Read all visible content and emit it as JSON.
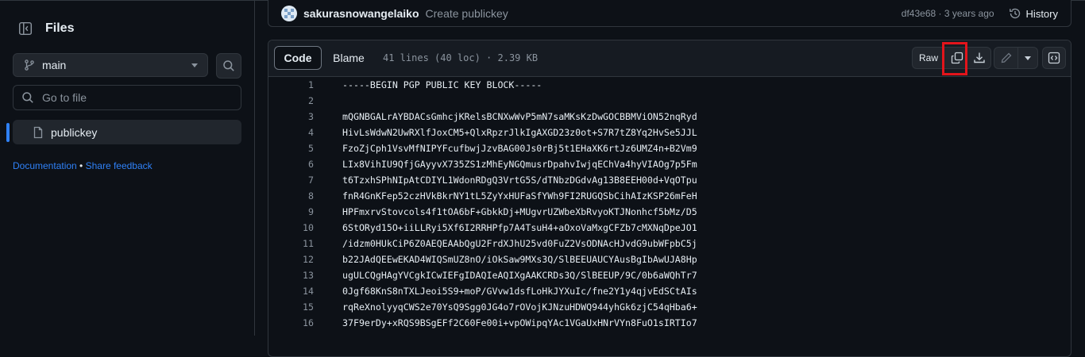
{
  "sidebar": {
    "title": "Files",
    "branch": "main",
    "search_placeholder": "Go to file",
    "tree": [
      {
        "label": "publickey"
      }
    ],
    "links": {
      "documentation": "Documentation",
      "separator": " • ",
      "feedback": "Share feedback"
    }
  },
  "commit": {
    "author": "sakurasnowangelaiko",
    "message": "Create publickey",
    "sha_age": "df43e68 · 3 years ago",
    "history_label": "History"
  },
  "file": {
    "tabs": {
      "code": "Code",
      "blame": "Blame"
    },
    "info": "41 lines (40 loc) · 2.39 KB",
    "raw_label": "Raw",
    "lines": [
      {
        "n": "1",
        "text": "-----BEGIN PGP PUBLIC KEY BLOCK-----"
      },
      {
        "n": "2",
        "text": ""
      },
      {
        "n": "3",
        "text": "mQGNBGALrAYBDACsGmhcjKRelsBCNXwWvP5mN7saMKsKzDwGOCBBMViON52nqRyd"
      },
      {
        "n": "4",
        "text": "HivLsWdwN2UwRXlfJoxCM5+QlxRpzrJlkIgAXGD23z0ot+S7R7tZ8Yq2HvSe5JJL"
      },
      {
        "n": "5",
        "text": "FzoZjCph1VsvMfNIPYFcufbwjJzvBAG00Js0rBj5t1EHaXK6rtJz6UMZ4n+B2Vm9"
      },
      {
        "n": "6",
        "text": "LIx8VihIU9QfjGAyyvX735ZS1zMhEyNGQmusrDpahvIwjqEChVa4hyVIAOg7p5Fm"
      },
      {
        "n": "7",
        "text": "t6TzxhSPhNIpAtCDIYL1WdonRDgQ3VrtG5S/dTNbzDGdvAg13B8EEH00d+VqOTpu"
      },
      {
        "n": "8",
        "text": "fnR4GnKFep52czHVkBkrNY1tL5ZyYxHUFaSfYWh9FI2RUGQSbCihAIzKSP26mFeH"
      },
      {
        "n": "9",
        "text": "HPFmxrvStovcols4f1tOA6bF+GbkkDj+MUgvrUZWbeXbRvyoKTJNonhcf5bMz/D5"
      },
      {
        "n": "10",
        "text": "6StORyd15O+iiLLRyi5Xf6I2RRHPfp7A4TsuH4+aOxoVaMxgCFZb7cMXNqDpeJO1"
      },
      {
        "n": "11",
        "text": "/idzm0HUkCiP6Z0AEQEAAbQgU2FrdXJhU25vd0FuZ2VsODNAcHJvdG9ubWFpbC5j"
      },
      {
        "n": "12",
        "text": "b22JAdQEEwEKAD4WIQSmUZ8nO/iOkSaw9MXs3Q/SlBEEUAUCYAusBgIbAwUJA8Hp"
      },
      {
        "n": "13",
        "text": "ugULCQgHAgYVCgkICwIEFgIDAQIeAQIXgAAKCRDs3Q/SlBEEUP/9C/0b6aWQhTr7"
      },
      {
        "n": "14",
        "text": "0Jgf68KnS8nTXLJeoi5S9+moP/GVvw1dsfLoHkJYXuIc/fne2Y1y4qjvEdSCtAIs"
      },
      {
        "n": "15",
        "text": "rqReXnolyyqCWS2e70YsQ9Sgg0JG4o7rOVojKJNzuHDWQ944yhGk6zjC54qHba6+"
      },
      {
        "n": "16",
        "text": "37F9erDy+xRQS9BSgEFf2C60Fe00i+vpOWipqYAc1VGaUxHNrVYn8FuO1sIRTIo7"
      }
    ]
  },
  "colors": {
    "accent": "#2f81f7",
    "highlight": "#e3141b",
    "background": "#0d1117"
  },
  "icons": [
    "sidebar-collapse-icon",
    "git-branch-icon",
    "search-icon",
    "file-icon",
    "history-icon",
    "copy-icon",
    "download-icon",
    "pencil-icon",
    "triangle-down-icon",
    "symbols-icon"
  ]
}
